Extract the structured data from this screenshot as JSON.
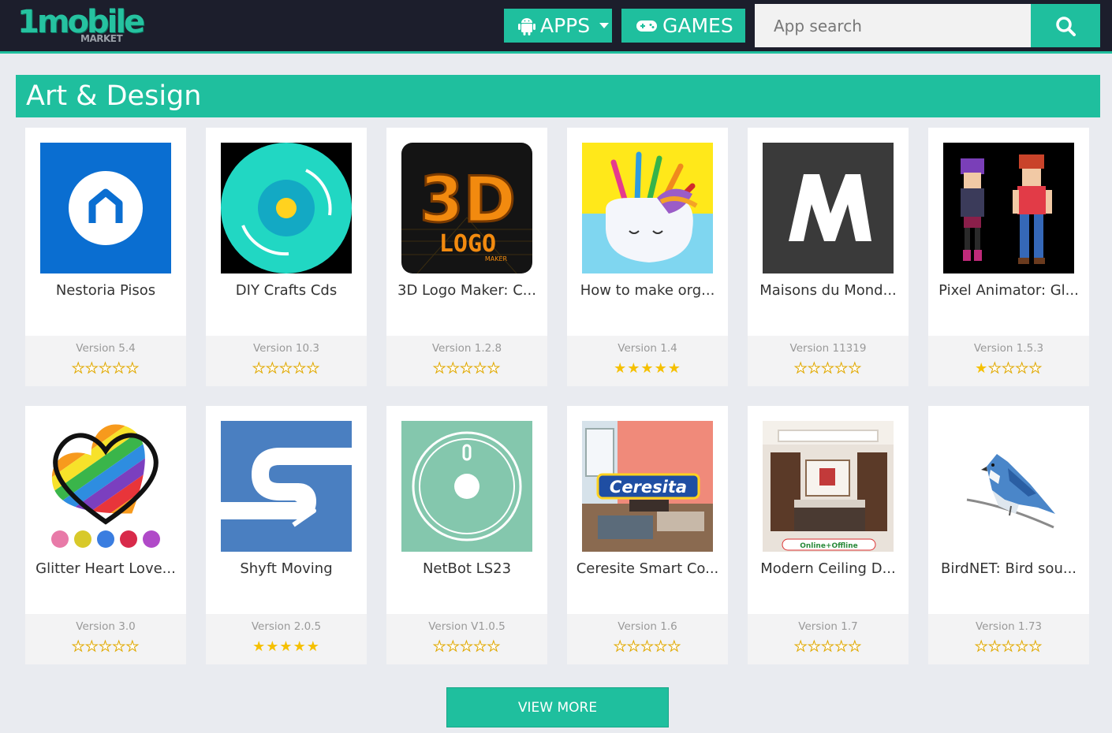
{
  "header": {
    "logo_main": "1mobile",
    "logo_sub": "MARKET",
    "apps_label": "APPS",
    "games_label": "GAMES",
    "search_placeholder": "App search"
  },
  "section": {
    "title": "Art & Design"
  },
  "apps": [
    {
      "name": "Nestoria Pisos",
      "version": "Version 5.4",
      "rating": 0,
      "icon": "nestoria-house-icon"
    },
    {
      "name": "DIY Crafts Cds",
      "version": "Version 10.3",
      "rating": 0,
      "icon": "cd-disc-icon"
    },
    {
      "name": "3D Logo Maker: C...",
      "version": "Version 1.2.8",
      "rating": 0,
      "icon": "3d-logo-icon"
    },
    {
      "name": "How to make org...",
      "version": "Version 1.4",
      "rating": 5,
      "icon": "unicorn-pen-holder-icon"
    },
    {
      "name": "Maisons du Mond...",
      "version": "Version 11319",
      "rating": 0,
      "icon": "m-letter-icon"
    },
    {
      "name": "Pixel Animator: Gl...",
      "version": "Version 1.5.3",
      "rating": 1,
      "icon": "pixel-characters-icon"
    },
    {
      "name": "Glitter Heart Love...",
      "version": "Version 3.0",
      "rating": 0,
      "icon": "glitter-heart-icon"
    },
    {
      "name": "Shyft Moving",
      "version": "Version 2.0.5",
      "rating": 5,
      "icon": "shyft-s-icon"
    },
    {
      "name": "NetBot LS23",
      "version": "Version V1.0.5",
      "rating": 0,
      "icon": "robot-vacuum-icon"
    },
    {
      "name": "Ceresite Smart Co...",
      "version": "Version 1.6",
      "rating": 0,
      "icon": "ceresita-room-icon"
    },
    {
      "name": "Modern Ceiling D...",
      "version": "Version 1.7",
      "rating": 0,
      "icon": "bedroom-ceiling-icon"
    },
    {
      "name": "BirdNET: Bird sou...",
      "version": "Version 1.73",
      "rating": 0,
      "icon": "blue-jay-icon"
    }
  ],
  "ceresita_label": "Ceresita",
  "online_offline_label": "Online+Offline",
  "view_more_label": "VIEW MORE",
  "colors": {
    "accent": "#1fbf9e",
    "header_bg": "#1c1e2c",
    "star": "#f5c000"
  }
}
